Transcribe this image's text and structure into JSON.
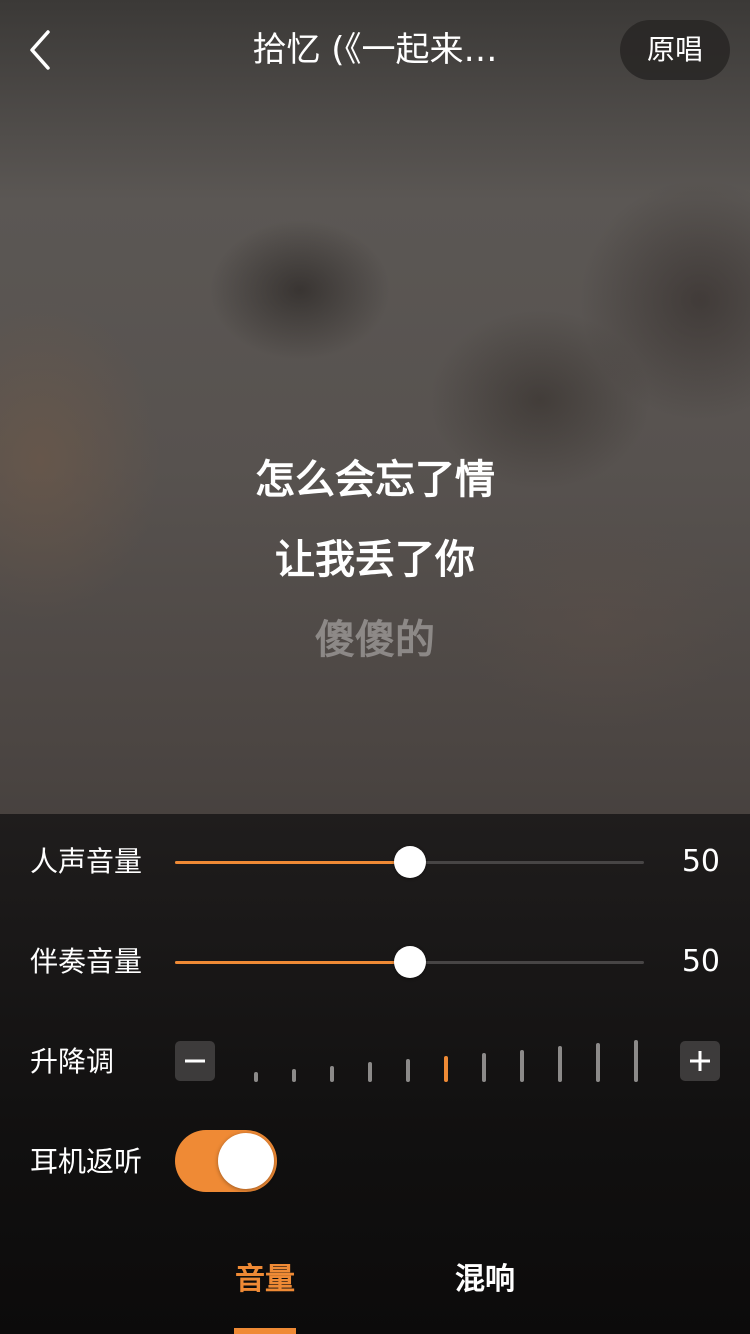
{
  "header": {
    "title": "拾忆 (《一起来…",
    "original_button": "原唱",
    "back_icon": "chevron-left-icon"
  },
  "lyrics": {
    "line1": "怎么会忘了情",
    "line2": "让我丢了你",
    "line3": "傻傻的"
  },
  "panel": {
    "vocal_volume": {
      "label": "人声音量",
      "value": "50",
      "level": 0.5
    },
    "accompaniment_volume": {
      "label": "伴奏音量",
      "value": "50",
      "level": 0.5
    },
    "pitch": {
      "label": "升降调",
      "minus_icon": "minus-icon",
      "plus_icon": "plus-icon",
      "steps": 11,
      "selected_step": 5
    },
    "ear_monitor": {
      "label": "耳机返听",
      "enabled": true
    }
  },
  "tabs": [
    {
      "label": "音量",
      "active": true
    },
    {
      "label": "混响",
      "active": false
    }
  ],
  "colors": {
    "accent": "#ef8a35",
    "track": "#474545",
    "panel": "#141313"
  }
}
